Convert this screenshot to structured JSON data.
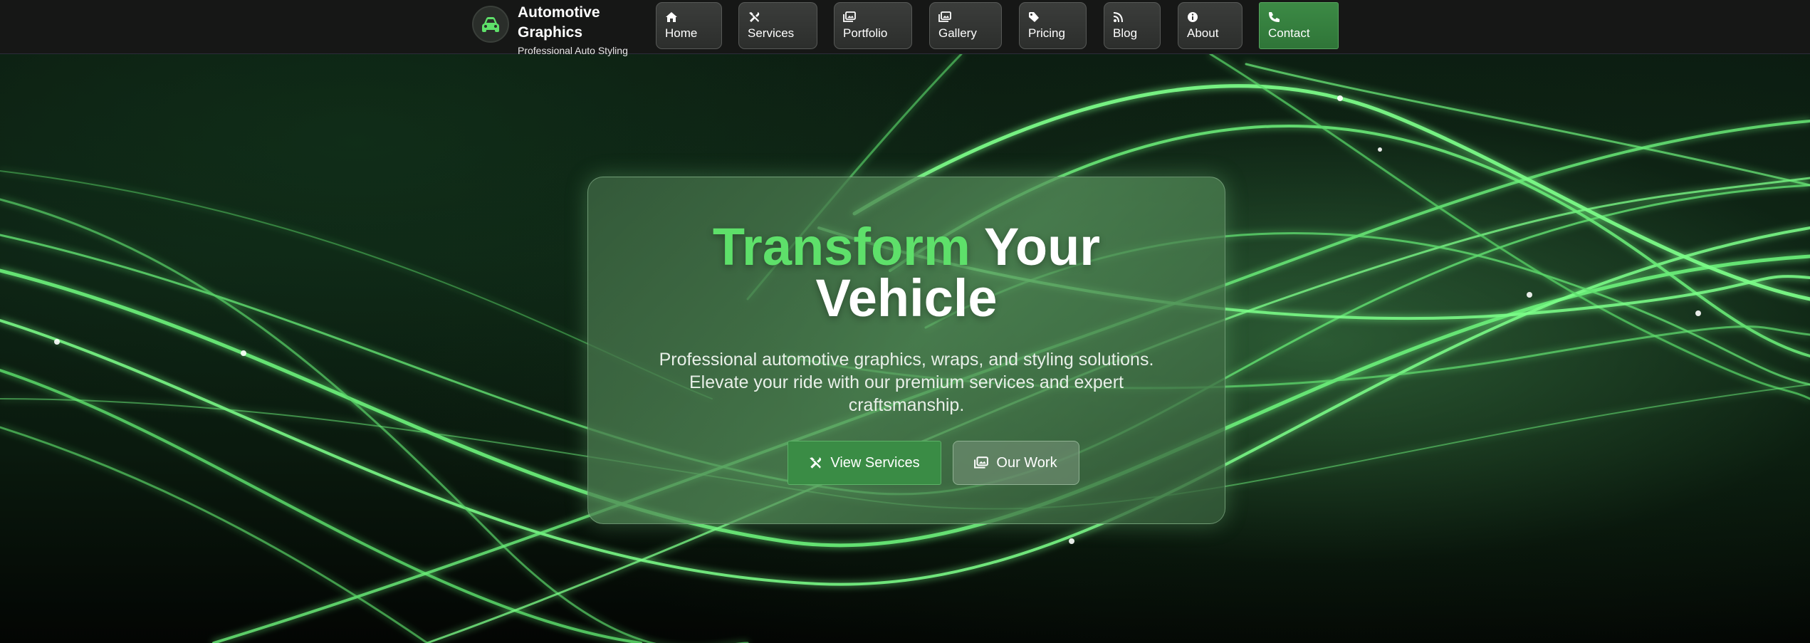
{
  "brand": {
    "title": "Automotive Graphics",
    "subtitle": "Professional Auto Styling",
    "logo_icon": "car-icon"
  },
  "nav": {
    "items": [
      {
        "label": "Home",
        "icon": "home-icon"
      },
      {
        "label": "Services",
        "icon": "tools-icon"
      },
      {
        "label": "Portfolio",
        "icon": "images-icon"
      },
      {
        "label": "Gallery",
        "icon": "images-icon"
      },
      {
        "label": "Pricing",
        "icon": "tag-icon"
      },
      {
        "label": "Blog",
        "icon": "rss-icon"
      },
      {
        "label": "About",
        "icon": "info-icon"
      },
      {
        "label": "Contact",
        "icon": "phone-icon"
      }
    ],
    "active": "Contact"
  },
  "hero": {
    "title_accent": "Transform",
    "title_rest_line1": " Your",
    "title_line2": "Vehicle",
    "subtitle": "Professional automotive graphics, wraps, and styling solutions. Elevate your ride with our premium services and expert craftsmanship.",
    "primary_button": "View Services",
    "secondary_button": "Our Work"
  },
  "colors": {
    "accent": "#5ee06a",
    "active_nav": "#3a8c45",
    "navbar_bg": "#161716",
    "wave": "#7dff8a"
  }
}
